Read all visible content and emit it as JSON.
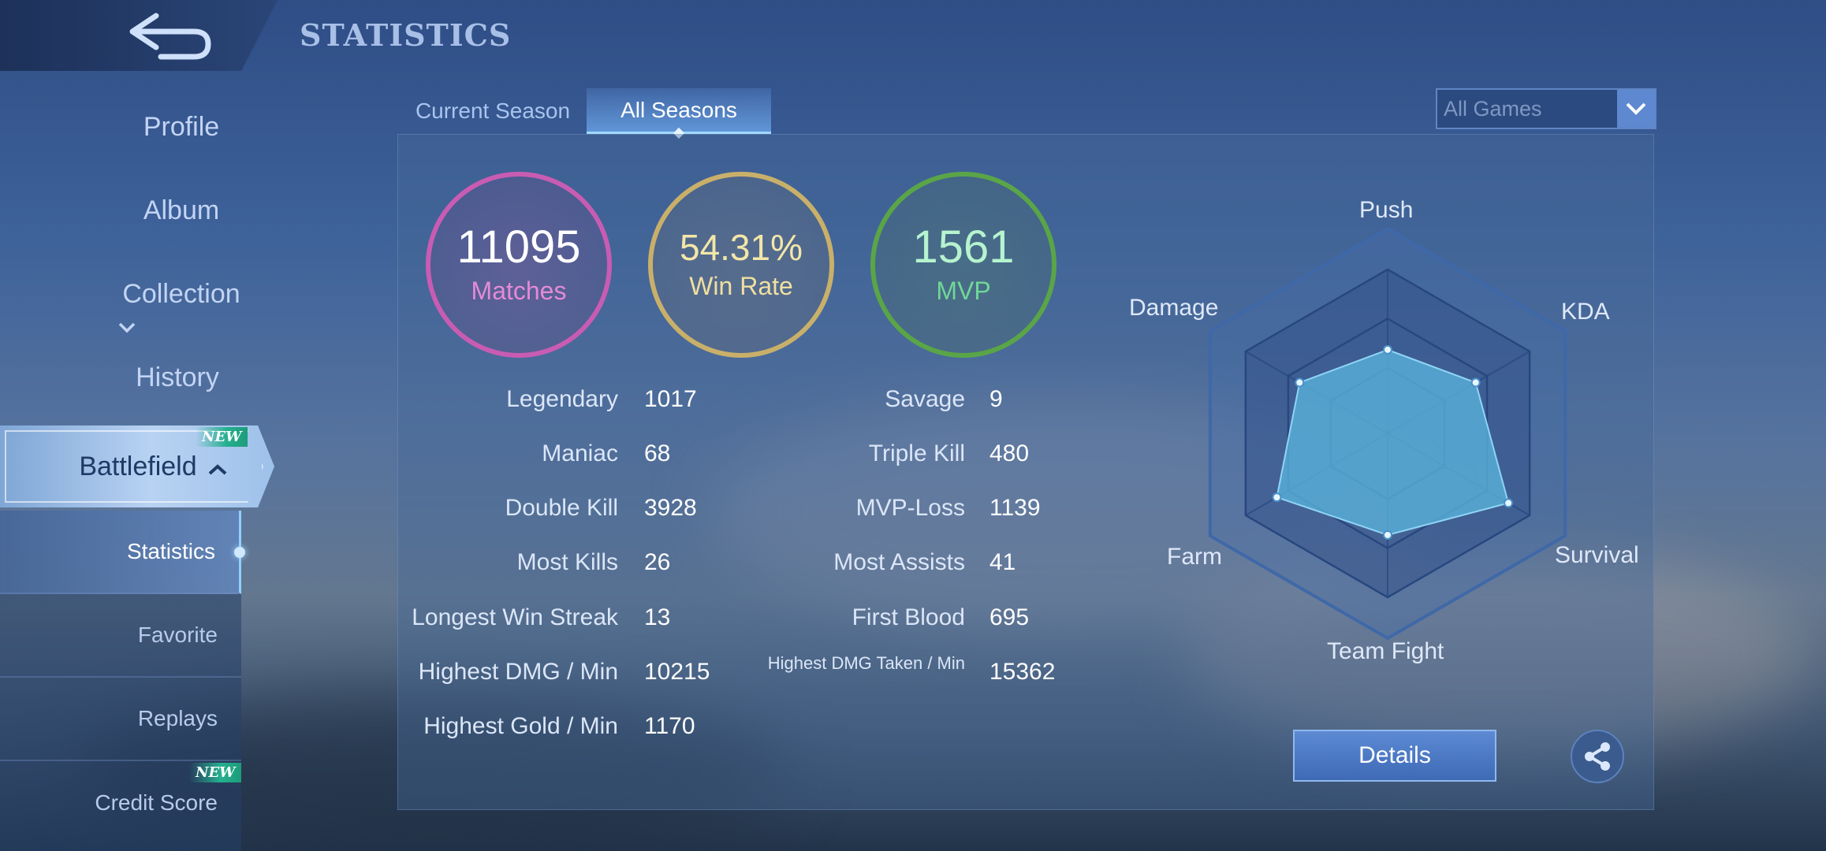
{
  "header": {
    "title": "STATISTICS",
    "back_icon": "back-arrow-icon"
  },
  "sidebar": {
    "items": [
      {
        "label": "Profile"
      },
      {
        "label": "Album"
      },
      {
        "label": "Collection"
      },
      {
        "label": "History"
      },
      {
        "label": "Battlefield",
        "badge": "NEW"
      }
    ],
    "sub_items": [
      {
        "label": "Statistics",
        "active": true
      },
      {
        "label": "Favorite"
      },
      {
        "label": "Replays"
      },
      {
        "label": "Credit Score",
        "badge": "NEW"
      }
    ]
  },
  "tabs": [
    {
      "label": "Current Season",
      "active": false
    },
    {
      "label": "All Seasons",
      "active": true
    }
  ],
  "filter": {
    "selected": "All Games"
  },
  "summary": {
    "matches": {
      "value": "11095",
      "label": "Matches",
      "color": "#c85cb3"
    },
    "win_rate": {
      "value": "54.31%",
      "label": "Win Rate",
      "color": "#c9b06a"
    },
    "mvp": {
      "value": "1561",
      "label": "MVP",
      "color": "#5aa548"
    }
  },
  "stats_left": [
    {
      "label": "Legendary",
      "value": "1017"
    },
    {
      "label": "Maniac",
      "value": "68"
    },
    {
      "label": "Double Kill",
      "value": "3928"
    },
    {
      "label": "Most Kills",
      "value": "26"
    },
    {
      "label": "Longest Win Streak",
      "value": "13"
    },
    {
      "label": "Highest DMG / Min",
      "value": "10215"
    },
    {
      "label": "Highest Gold / Min",
      "value": "1170"
    }
  ],
  "stats_right": [
    {
      "label": "Savage",
      "value": "9"
    },
    {
      "label": "Triple Kill",
      "value": "480"
    },
    {
      "label": "MVP-Loss",
      "value": "1139"
    },
    {
      "label": "Most Assists",
      "value": "41"
    },
    {
      "label": "First Blood",
      "value": "695"
    },
    {
      "label": "Highest DMG Taken / Min",
      "value": "15362"
    }
  ],
  "radar": {
    "axes": [
      "Push",
      "KDA",
      "Survival",
      "Team Fight",
      "Farm",
      "Damage"
    ],
    "values": [
      0.51,
      0.62,
      0.85,
      0.62,
      0.78,
      0.62
    ],
    "fill_color": "#5ab4dc"
  },
  "actions": {
    "details_label": "Details",
    "share_icon": "share-icon"
  }
}
